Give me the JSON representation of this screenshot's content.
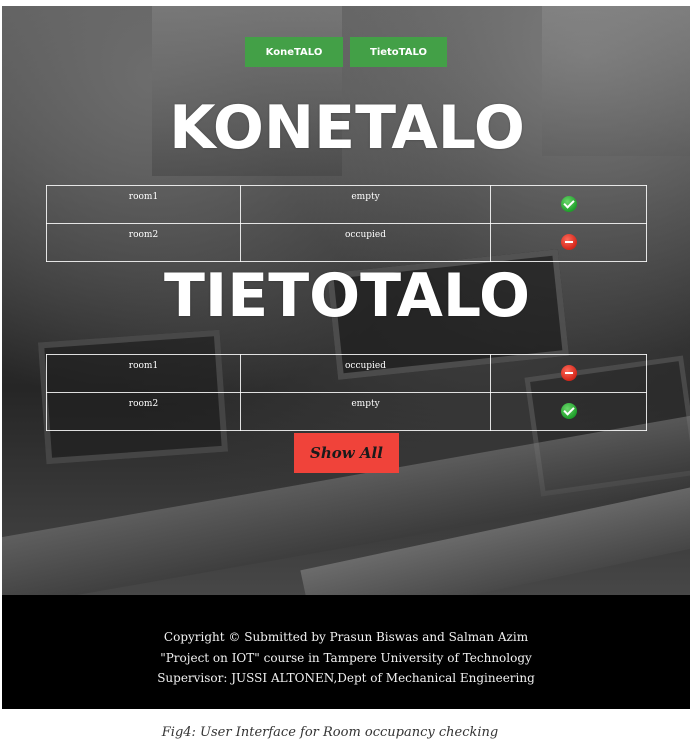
{
  "nav": {
    "kone_label": "KoneTALO",
    "tieto_label": "TietoTALO"
  },
  "konetalo": {
    "title": "KONETALO",
    "rooms": [
      {
        "name": "room1",
        "status": "empty",
        "icon": "check-icon"
      },
      {
        "name": "room2",
        "status": "occupied",
        "icon": "no-entry-icon"
      }
    ]
  },
  "tietotalo": {
    "title": "TIETOTALO",
    "rooms": [
      {
        "name": "room1",
        "status": "occupied",
        "icon": "no-entry-icon"
      },
      {
        "name": "room2",
        "status": "empty",
        "icon": "check-icon"
      }
    ]
  },
  "show_all_label": "Show All",
  "footer": {
    "line1": "Copyright © Submitted by Prasun Biswas and Salman Azim",
    "line2": "\"Project on IOT\" course in Tampere University of Technology",
    "line3": "Supervisor: JUSSI ALTONEN,Dept of Mechanical Engineering"
  },
  "caption": "Fig4: User Interface for Room occupancy checking",
  "colors": {
    "nav_green": "#43a047",
    "show_all_red": "#f0433a",
    "ok_green": "#1f9e2b",
    "busy_red": "#d3261a",
    "footer_bg": "#000000"
  }
}
